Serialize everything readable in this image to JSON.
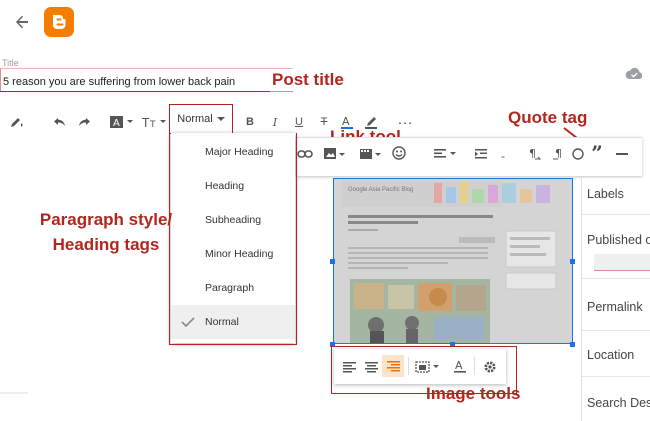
{
  "title_field": {
    "label": "Title",
    "value": "5 reason you are suffering from lower back pain"
  },
  "toolbar": {
    "paragraph_style": "Normal"
  },
  "paragraph_menu": {
    "items": [
      {
        "label": "Major Heading",
        "selected": false
      },
      {
        "label": "Heading",
        "selected": false
      },
      {
        "label": "Subheading",
        "selected": false
      },
      {
        "label": "Minor Heading",
        "selected": false
      },
      {
        "label": "Paragraph",
        "selected": false
      },
      {
        "label": "Normal",
        "selected": true
      }
    ]
  },
  "right_panel": {
    "items": [
      "Labels",
      "Published o",
      "Permalink",
      "Location",
      "Search Des"
    ]
  },
  "annotations": {
    "post_title": "Post title",
    "link_tool": "Link tool",
    "quote_tag": "Quote tag",
    "paragraph_style": "Paragraph style/\nHeading tags",
    "image_tools": "Image tools"
  },
  "embedded_image": {
    "brand_text": "Google  Asia Pacific Blog",
    "headline": "Bringing the internet to more visitors - starting with 10 million rail passengers a day"
  },
  "colors": {
    "accent": "#1a73e8",
    "annotation": "#b3261e",
    "blogger_orange": "#f57d00"
  }
}
